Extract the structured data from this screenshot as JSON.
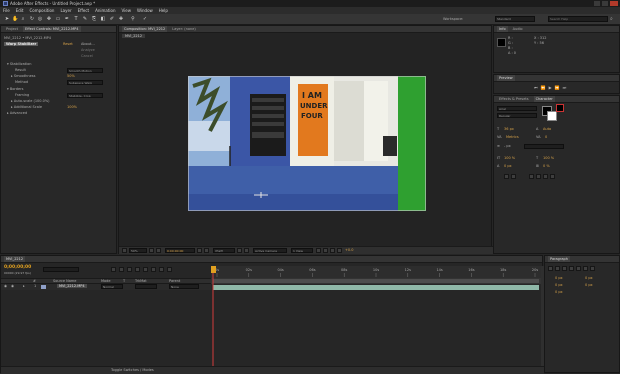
{
  "titlebar": {
    "title": "Adobe After Effects - Untitled Project.aep *"
  },
  "menu": [
    "File",
    "Edit",
    "Composition",
    "Layer",
    "Effect",
    "Animation",
    "View",
    "Window",
    "Help"
  ],
  "toolbar": {
    "workspace_label": "Workspace:",
    "workspace_value": "Standard",
    "search_placeholder": "Search Help"
  },
  "project_tabs": [
    "Project",
    "Effect Controls: MVI_2212.MP4"
  ],
  "effect_controls": {
    "breadcrumb": "MVI_2212 • MVI_2212.MP4",
    "effect_name": "Warp Stabilizer",
    "reset": "Reset",
    "about": "About...",
    "analyze": "Analyze",
    "cancel": "Cancel",
    "rows": [
      {
        "label": "Stabilization",
        "value": ""
      },
      {
        "label": "Result",
        "value": "Smooth Motion"
      },
      {
        "label": "Smoothness",
        "value": "50%"
      },
      {
        "label": "Method",
        "value": "Subspace Warp"
      },
      {
        "label": "Borders",
        "value": ""
      },
      {
        "label": "Framing",
        "value": "Stabilize, Crop"
      },
      {
        "label": "Auto-scale (100.0%)",
        "value": ""
      },
      {
        "label": "Additional Scale",
        "value": "100%"
      },
      {
        "label": "Advanced",
        "value": ""
      }
    ]
  },
  "comp_tabs": [
    "Composition: MVI_2212",
    "Layer: (none)"
  ],
  "comp_subtab": "MVI_2212",
  "comp_footer": {
    "zoom": "50%",
    "timecode": "0;00;00;00",
    "quality": "(Half)",
    "camera": "Active Camera",
    "views": "1 View",
    "offset": "+0.0"
  },
  "info": {
    "tabs": [
      "Info",
      "Audio"
    ],
    "r": "R :",
    "g": "G :",
    "b": "B :",
    "a": "A : 0",
    "x": "X : 312",
    "y": "Y : 56"
  },
  "preview_tab": "Preview",
  "effects_tabs": [
    "Effects & Presets",
    "Character"
  ],
  "character": {
    "font": "Arial",
    "style": "Regular",
    "size": "36 px",
    "leading": "Auto",
    "kerning": "Metrics",
    "tracking": "0",
    "stroke": "- px",
    "vscale": "100 %",
    "hscale": "100 %",
    "baseline": "0 px",
    "tsume": "0 %"
  },
  "timeline": {
    "tab": "MVI_2212",
    "timecode": "0;00;00;00",
    "fps": "00000 (29.97 fps)",
    "search_placeholder": "",
    "columns": [
      "#",
      "Source Name",
      "Mode",
      "T",
      "TrkMat",
      "Parent"
    ],
    "layer": {
      "num": "1",
      "name": "MVI_2212.MP4",
      "mode": "Normal",
      "parent": "None"
    },
    "ruler": [
      "0s",
      "02s",
      "04s",
      "06s",
      "08s",
      "10s",
      "12s",
      "14s",
      "16s",
      "18s",
      "20s"
    ],
    "footer": "Toggle Switches / Modes"
  },
  "paragraph": {
    "tab": "Paragraph",
    "v1": "0 px",
    "v2": "0 px",
    "v3": "0 px",
    "v4": "0 px",
    "v5": "0 px"
  },
  "colors": {
    "accent": "#d8a34a",
    "timecode": "#e0a020",
    "clip": "#8fb8a8",
    "playhead": "#d23c3c"
  }
}
